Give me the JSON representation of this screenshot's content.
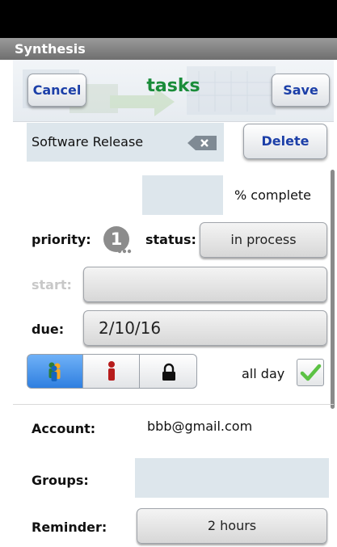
{
  "titlebar": {
    "title": "Synthesis"
  },
  "header": {
    "cancel_label": "Cancel",
    "title": "tasks",
    "save_label": "Save"
  },
  "task": {
    "name": "Software Release",
    "delete_label": "Delete",
    "percent_value": "",
    "percent_label": "% complete",
    "priority_label": "priority:",
    "priority_value": "1",
    "status_label": "status:",
    "status_value": "in process",
    "start_label": "start:",
    "start_value": "",
    "due_label": "due:",
    "due_value": "2/10/16",
    "allday_label": "all day",
    "allday_checked": true
  },
  "details": {
    "account_label": "Account:",
    "account_value": "bbb@gmail.com",
    "groups_label": "Groups:",
    "groups_value": "",
    "reminder_label": "Reminder:",
    "reminder_value": "2 hours"
  },
  "colors": {
    "accent": "#1c3fa8",
    "title_green": "#1a8c3a",
    "field_bg": "#dde6ec",
    "segment_active": "#3d8fe8"
  },
  "icons": [
    "clear-text-icon",
    "priority-badge-icon",
    "group-people-icon",
    "single-person-icon",
    "lock-icon",
    "checkmark-icon"
  ]
}
